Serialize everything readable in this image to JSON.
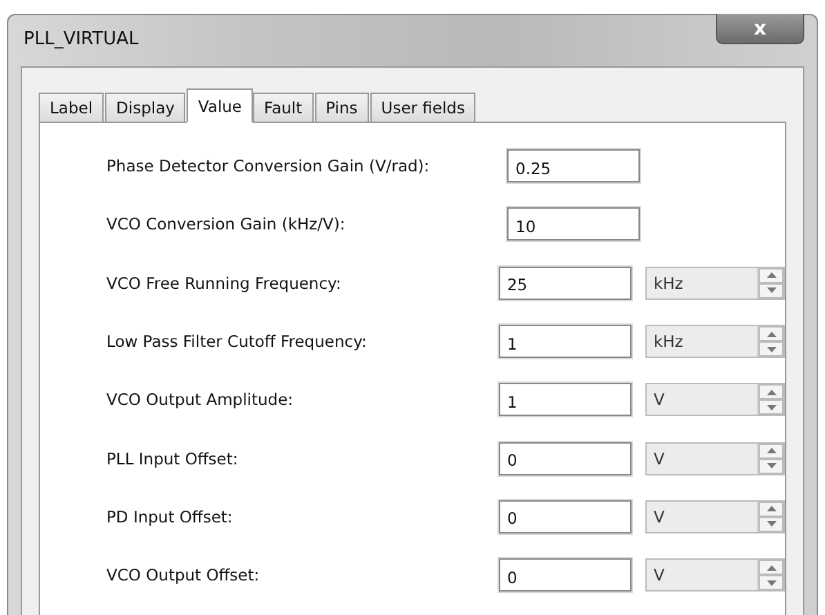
{
  "window": {
    "title": "PLL_VIRTUAL",
    "close": "x"
  },
  "tabs": [
    {
      "label": "Label",
      "selected": false
    },
    {
      "label": "Display",
      "selected": false
    },
    {
      "label": "Value",
      "selected": true
    },
    {
      "label": "Fault",
      "selected": false
    },
    {
      "label": "Pins",
      "selected": false
    },
    {
      "label": "User fields",
      "selected": false
    }
  ],
  "fields": [
    {
      "label": "Phase Detector Conversion Gain (V/rad):",
      "value": "0.25"
    },
    {
      "label": "VCO Conversion Gain (kHz/V):",
      "value": "10"
    },
    {
      "label": "VCO Free Running Frequency:",
      "value": "25",
      "unit": "kHz"
    },
    {
      "label": "Low Pass Filter Cutoff Frequency:",
      "value": "1",
      "unit": "kHz"
    },
    {
      "label": "VCO Output Amplitude:",
      "value": "1",
      "unit": "V"
    },
    {
      "label": "PLL Input Offset:",
      "value": "0",
      "unit": "V"
    },
    {
      "label": "PD Input Offset:",
      "value": "0",
      "unit": "V"
    },
    {
      "label": "VCO Output Offset:",
      "value": "0",
      "unit": "V"
    }
  ]
}
